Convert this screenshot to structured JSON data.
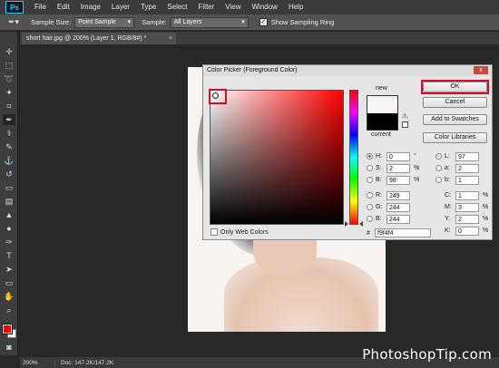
{
  "app": {
    "logo": "Ps"
  },
  "menu": [
    "File",
    "Edit",
    "Image",
    "Layer",
    "Type",
    "Select",
    "Filter",
    "View",
    "Window",
    "Help"
  ],
  "options": {
    "sample_size_label": "Sample Size:",
    "sample_size_value": "Point Sample",
    "sample_label": "Sample:",
    "sample_value": "All Layers",
    "show_ring_label": "Show Sampling Ring",
    "show_ring_checked": true
  },
  "document": {
    "tab_title": "short hair.jpg @ 200% (Layer 1, RGB/8#) *",
    "close": "×"
  },
  "status": {
    "zoom": "200%",
    "doc_size": "Doc: 147.2K/147.2K"
  },
  "watermark": "PhotoshopTip.com",
  "swatches": {
    "foreground": "#ff0000",
    "background": "#ffffff"
  },
  "dialog": {
    "title": "Color Picker (Foreground Color)",
    "close": "x",
    "new_label": "new",
    "current_label": "current",
    "new_color": "#f9f4f4",
    "current_color": "#000000",
    "buttons": {
      "ok": "OK",
      "cancel": "Cancel",
      "add_swatches": "Add to Swatches",
      "libraries": "Color Libraries"
    },
    "only_web": "Only Web Colors",
    "hsb": [
      {
        "label": "H:",
        "value": "0",
        "unit": "°",
        "selected": true
      },
      {
        "label": "S:",
        "value": "2",
        "unit": "%",
        "selected": false
      },
      {
        "label": "B:",
        "value": "98",
        "unit": "%",
        "selected": false
      }
    ],
    "rgb": [
      {
        "label": "R:",
        "value": "249"
      },
      {
        "label": "G:",
        "value": "244"
      },
      {
        "label": "B:",
        "value": "244"
      }
    ],
    "lab": [
      {
        "label": "L:",
        "value": "97"
      },
      {
        "label": "a:",
        "value": "2"
      },
      {
        "label": "b:",
        "value": "1"
      }
    ],
    "cmyk": [
      {
        "label": "C:",
        "value": "1",
        "unit": "%"
      },
      {
        "label": "M:",
        "value": "3",
        "unit": "%"
      },
      {
        "label": "Y:",
        "value": "2",
        "unit": "%"
      },
      {
        "label": "K:",
        "value": "0",
        "unit": "%"
      }
    ],
    "hex_label": "#",
    "hex_value": "f9f4f4"
  },
  "accent": {
    "highlight": "#d3102a"
  }
}
